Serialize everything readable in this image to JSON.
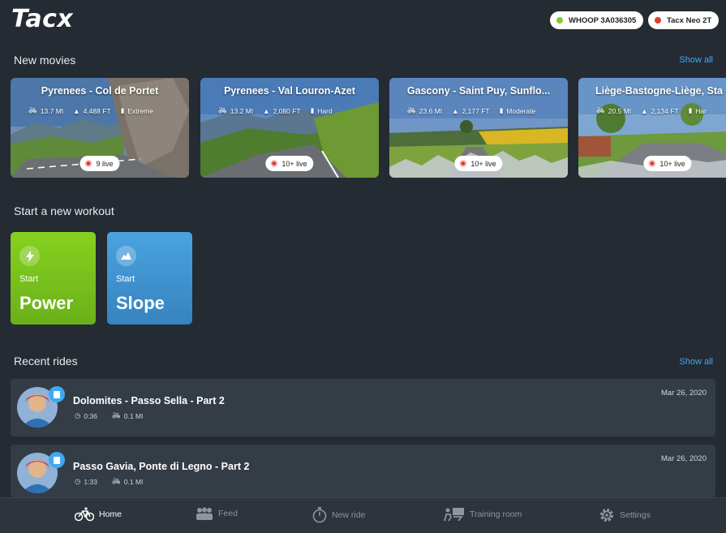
{
  "app": {
    "logo": "Tacx"
  },
  "devices": [
    {
      "label": "WHOOP 3A036305",
      "status_color": "#7ccd2f"
    },
    {
      "label": "Tacx Neo 2T",
      "status_color": "#e53935"
    }
  ],
  "movies_section": {
    "title": "New movies",
    "show_all": "Show all"
  },
  "movies": [
    {
      "title": "Pyrenees - Col de Portet",
      "distance": "13.7 MI",
      "elevation": "4,488 FT",
      "difficulty": "Extreme",
      "live": "9 live"
    },
    {
      "title": "Pyrenees - Val Louron-Azet",
      "distance": "13.2 MI",
      "elevation": "2,080 FT",
      "difficulty": "Hard",
      "live": "10+ live"
    },
    {
      "title": "Gascony - Saint Puy, Sunflo...",
      "distance": "23.6 MI",
      "elevation": "2,177 FT",
      "difficulty": "Moderate",
      "live": "10+ live"
    },
    {
      "title": "Liège-Bastogne-Liège, Sta",
      "distance": "20.5 MI",
      "elevation": "2,134 FT",
      "difficulty": "Har",
      "live": "10+ live"
    }
  ],
  "workout_section": {
    "title": "Start a new workout"
  },
  "workouts": [
    {
      "start": "Start",
      "name": "Power",
      "color": "#7cc520",
      "icon": "lightning-icon"
    },
    {
      "start": "Start",
      "name": "Slope",
      "color": "#3e8fce",
      "icon": "mountain-icon"
    }
  ],
  "rides_section": {
    "title": "Recent rides",
    "show_all": "Show all"
  },
  "rides": [
    {
      "title": "Dolomites - Passo Sella - Part 2",
      "duration": "0:36",
      "distance": "0.1 MI",
      "date": "Mar 26, 2020"
    },
    {
      "title": "Passo Gavia, Ponte di Legno - Part 2",
      "duration": "1:33",
      "distance": "0.1 MI",
      "date": "Mar 26, 2020"
    }
  ],
  "nav": [
    {
      "label": "Home",
      "icon": "bike-icon",
      "active": true
    },
    {
      "label": "Feed",
      "icon": "people-icon",
      "active": false
    },
    {
      "label": "New ride",
      "icon": "stopwatch-icon",
      "active": false
    },
    {
      "label": "Training room",
      "icon": "training-room-icon",
      "active": false
    },
    {
      "label": "Settings",
      "icon": "gear-icon",
      "active": false
    }
  ],
  "colors": {
    "background": "#252b33",
    "accent": "#3fa9f5",
    "card": "#343c46"
  }
}
